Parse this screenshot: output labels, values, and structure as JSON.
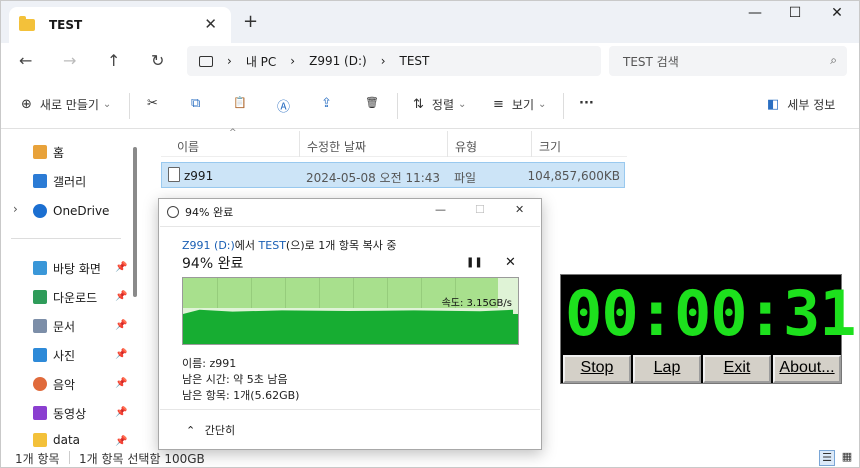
{
  "window": {
    "tab_title": "TEST",
    "tab_close": "✕",
    "new_tab": "+",
    "minimize": "—",
    "maximize": "☐",
    "close": "✕"
  },
  "nav": {
    "back": "←",
    "forward": "→",
    "up": "↑",
    "refresh": "↻"
  },
  "breadcrumb": {
    "chev": "›",
    "items": [
      "내 PC",
      "Z991 (D:)",
      "TEST"
    ]
  },
  "search": {
    "placeholder": "TEST 검색",
    "icon": "⌕"
  },
  "toolbar": {
    "new_label": "새로 만들기",
    "new_icon": "⊕",
    "cut_icon": "✂",
    "copy_icon": "⧉",
    "paste_icon": "📋",
    "rename_icon": "Ⓐ",
    "share_icon": "⇪",
    "delete_icon": "🗑",
    "sort_label": "정렬",
    "sort_icon": "⇅",
    "view_label": "보기",
    "view_icon": "≡",
    "more": "···",
    "details_label": "세부 정보",
    "details_icon": "◧",
    "dropdown_caret": "⌄"
  },
  "sidebar": {
    "items": [
      {
        "label": "홈",
        "color": "#e8a23a",
        "pinned": false
      },
      {
        "label": "갤러리",
        "color": "#2b7bd5",
        "pinned": false
      },
      {
        "label": "OneDrive",
        "color": "#1b6fd1",
        "pinned": false
      },
      {
        "label": "바탕 화면",
        "color": "#3a97d8",
        "pinned": true
      },
      {
        "label": "다운로드",
        "color": "#2f9c5a",
        "pinned": true
      },
      {
        "label": "문서",
        "color": "#7c8ea8",
        "pinned": true
      },
      {
        "label": "사진",
        "color": "#2e8ad8",
        "pinned": true
      },
      {
        "label": "음악",
        "color": "#e06a3b",
        "pinned": true
      },
      {
        "label": "동영상",
        "color": "#8b3fd0",
        "pinned": true
      },
      {
        "label": "data",
        "color": "#f3c13a",
        "pinned": true
      }
    ],
    "expand_chev": "›",
    "pin_icon": "📌"
  },
  "columns": {
    "name": "이름",
    "modified": "수정한 날짜",
    "type": "유형",
    "size": "크기",
    "sort_arrow": "^"
  },
  "files": [
    {
      "name": "z991",
      "modified": "2024-05-08 오전 11:43",
      "type": "파일",
      "size": "104,857,600KB"
    }
  ],
  "status": {
    "count": "1개 항목",
    "selected": "1개 항목 선택함 100GB"
  },
  "copy_dialog": {
    "title": "94% 완료",
    "from_prefix": "Z991 (D:)",
    "from_mid": "에서 ",
    "to": "TEST",
    "from_suffix": "(으)로 1개 항목 복사 중",
    "percent_label": "94% 완료",
    "progress": 0.94,
    "speed": "속도: 3.15GB/s",
    "pause_icon": "❚❚",
    "cancel_icon": "✕",
    "name_line": "이름: z991",
    "time_line": "남은 시간: 약 5초 남음",
    "items_line": "남은 항목: 1개(5.62GB)",
    "collapse_label": "간단히",
    "collapse_icon": "⌃",
    "min_icon": "—",
    "max_icon": "☐",
    "close_icon": "✕",
    "colors": {
      "bar_light": "#a8e08d",
      "bar_dark": "#17ad32"
    }
  },
  "stopwatch": {
    "time": "00:00:31",
    "buttons": [
      "Stop",
      "Lap",
      "Exit",
      "About..."
    ],
    "digit_color": "#1de01d"
  },
  "view_icons": [
    "☰",
    "▦"
  ]
}
